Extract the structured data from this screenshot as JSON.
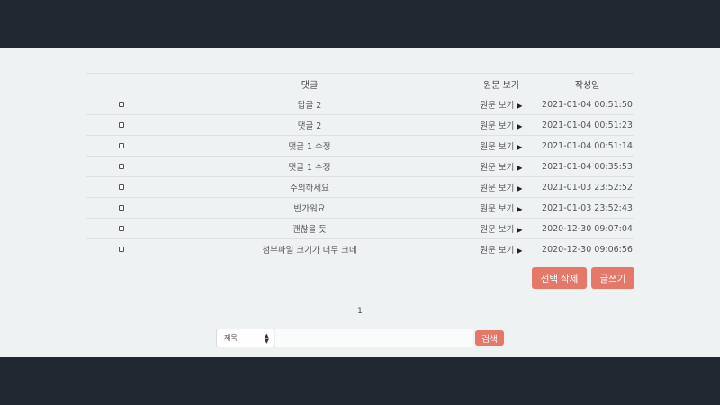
{
  "table": {
    "headers": {
      "title": "댓글",
      "view": "원문 보기",
      "date": "작성일"
    },
    "rows": [
      {
        "title": "답글 2",
        "view": "원문 보기",
        "date": "2021-01-04 00:51:50"
      },
      {
        "title": "댓글 2",
        "view": "원문 보기",
        "date": "2021-01-04 00:51:23"
      },
      {
        "title": "댓글 1 수정",
        "view": "원문 보기",
        "date": "2021-01-04 00:51:14"
      },
      {
        "title": "댓글 1 수정",
        "view": "원문 보기",
        "date": "2021-01-04 00:35:53"
      },
      {
        "title": "주의하세요",
        "view": "원문 보기",
        "date": "2021-01-03 23:52:52"
      },
      {
        "title": "반가워요",
        "view": "원문 보기",
        "date": "2021-01-03 23:52:43"
      },
      {
        "title": "괜찮을 듯",
        "view": "원문 보기",
        "date": "2020-12-30 09:07:04"
      },
      {
        "title": "첨부파일 크기가 너무 크네",
        "view": "원문 보기",
        "date": "2020-12-30 09:06:56"
      }
    ]
  },
  "actions": {
    "delete_label": "선택 삭제",
    "write_label": "글쓰기"
  },
  "pagination": {
    "current": "1"
  },
  "search": {
    "field_selected": "제목",
    "query": "",
    "button_label": "검색"
  },
  "colors": {
    "accent": "#e4796a",
    "header_bg": "#222831",
    "content_bg": "#eff2f3"
  },
  "icons": {
    "row_arrow": "play-arrow-icon",
    "select_chevron": "updown-chevron-icon"
  }
}
